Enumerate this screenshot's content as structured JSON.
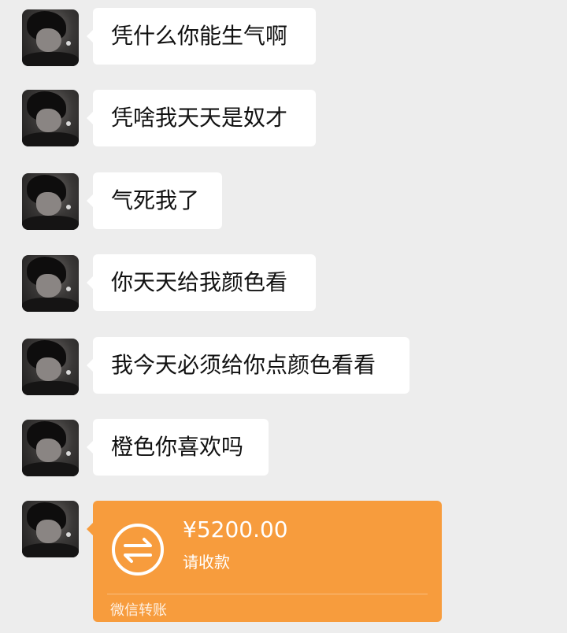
{
  "messages": [
    {
      "text": "凭什么你能生气啊"
    },
    {
      "text": "凭啥我天天是奴才"
    },
    {
      "text": "气死我了"
    },
    {
      "text": "你天天给我颜色看"
    },
    {
      "text": "我今天必须给你点颜色看看"
    },
    {
      "text": "橙色你喜欢吗"
    }
  ],
  "transfer": {
    "amount": "¥5200.00",
    "status": "请收款",
    "footer": "微信转账",
    "icon": "transfer-arrows-icon",
    "color": "#f79c3d"
  },
  "colors": {
    "background": "#ededed",
    "bubble": "#ffffff",
    "text": "#111111"
  }
}
